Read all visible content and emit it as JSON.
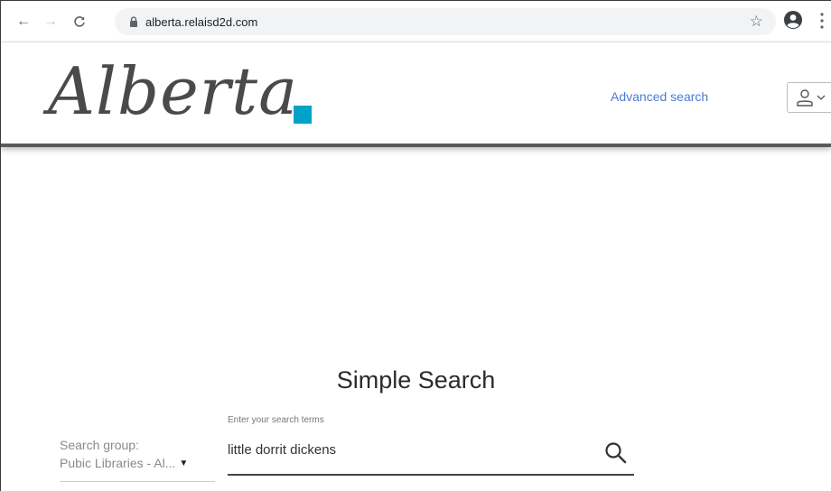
{
  "browser": {
    "url": "alberta.relaisd2d.com",
    "icons": {
      "back": "arrow-left-icon",
      "forward": "arrow-right-icon",
      "reload": "reload-icon",
      "lock": "lock-icon",
      "bookmark": "star-icon",
      "profile": "account-circle-icon",
      "menu": "kebab-menu-icon"
    },
    "glyphs": {
      "back": "←",
      "forward": "→",
      "reload": "C",
      "star": "☆"
    }
  },
  "header": {
    "logo_text": "Alberta",
    "advanced_search_label": "Advanced search",
    "user_menu_icon": "user-icon",
    "accent_color": "#00a3c8",
    "link_color": "#4d79d6"
  },
  "main": {
    "title": "Simple Search",
    "search_group": {
      "label": "Search group:",
      "value": "Pubic Libraries - Al...",
      "caret": "▼"
    },
    "search": {
      "label": "Enter your search terms",
      "value": "little dorrit dickens",
      "icon": "search-icon"
    }
  }
}
